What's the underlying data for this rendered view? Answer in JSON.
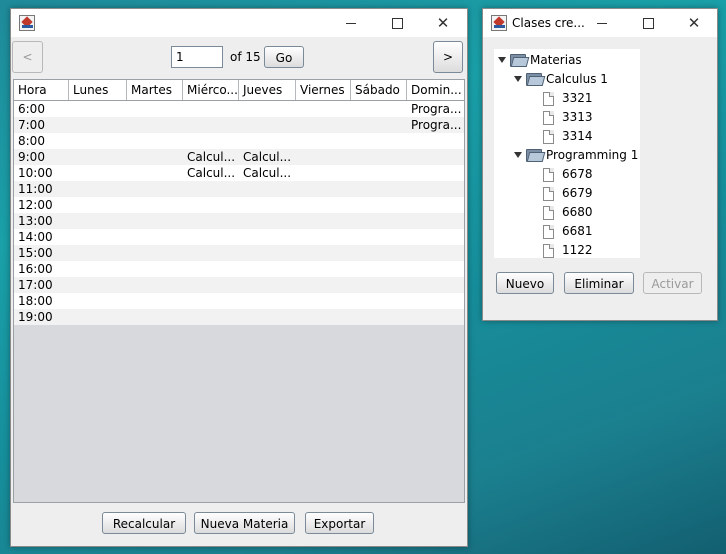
{
  "main_window": {
    "title": "",
    "pager": {
      "prev_label": "<",
      "page_value": "1",
      "of_label": "of 15",
      "go_label": "Go",
      "next_label": ">"
    },
    "table": {
      "columns": [
        "Hora",
        "Lunes",
        "Martes",
        "Miérco...",
        "Jueves",
        "Viernes",
        "Sábado",
        "Domin..."
      ],
      "rows": [
        [
          "6:00",
          "",
          "",
          "",
          "",
          "",
          "",
          "Progra..."
        ],
        [
          "7:00",
          "",
          "",
          "",
          "",
          "",
          "",
          "Progra..."
        ],
        [
          "8:00",
          "",
          "",
          "",
          "",
          "",
          "",
          ""
        ],
        [
          "9:00",
          "",
          "",
          "Calcul...",
          "Calcul...",
          "",
          "",
          ""
        ],
        [
          "10:00",
          "",
          "",
          "Calcul...",
          "Calcul...",
          "",
          "",
          ""
        ],
        [
          "11:00",
          "",
          "",
          "",
          "",
          "",
          "",
          ""
        ],
        [
          "12:00",
          "",
          "",
          "",
          "",
          "",
          "",
          ""
        ],
        [
          "13:00",
          "",
          "",
          "",
          "",
          "",
          "",
          ""
        ],
        [
          "14:00",
          "",
          "",
          "",
          "",
          "",
          "",
          ""
        ],
        [
          "15:00",
          "",
          "",
          "",
          "",
          "",
          "",
          ""
        ],
        [
          "16:00",
          "",
          "",
          "",
          "",
          "",
          "",
          ""
        ],
        [
          "17:00",
          "",
          "",
          "",
          "",
          "",
          "",
          ""
        ],
        [
          "18:00",
          "",
          "",
          "",
          "",
          "",
          "",
          ""
        ],
        [
          "19:00",
          "",
          "",
          "",
          "",
          "",
          "",
          ""
        ]
      ]
    },
    "buttons": {
      "recalcular": "Recalcular",
      "nueva_materia": "Nueva Materia",
      "exportar": "Exportar"
    }
  },
  "side_window": {
    "title": "Clases cre...",
    "tree": {
      "root": "Materias",
      "subjects": [
        {
          "name": "Calculus 1",
          "classes": [
            "3321",
            "3313",
            "3314"
          ]
        },
        {
          "name": "Programming 1",
          "classes": [
            "6678",
            "6679",
            "6680",
            "6681",
            "1122"
          ]
        }
      ]
    },
    "buttons": {
      "nuevo": "Nuevo",
      "eliminar": "Eliminar",
      "activar": "Activar"
    }
  },
  "window_controls": {
    "minimize": "—",
    "maximize": "☐",
    "close": "✕"
  }
}
